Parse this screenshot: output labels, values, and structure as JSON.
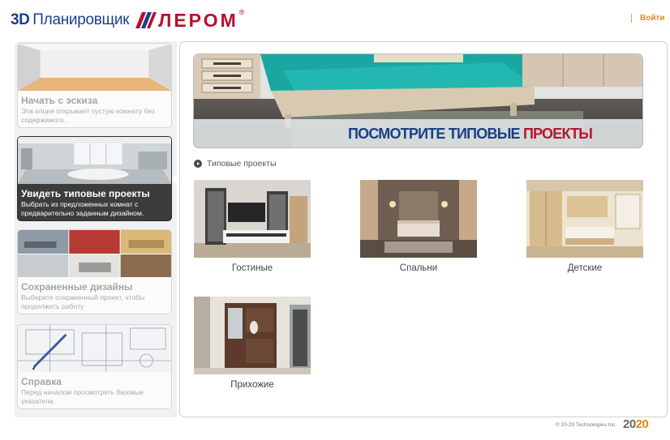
{
  "header": {
    "logo_3d": "3D",
    "logo_planner": "Планировщик",
    "logo_brand": "ЛЕРОМ",
    "logo_reg": "®",
    "login_label": "Войти"
  },
  "sidebar": {
    "items": [
      {
        "title": "Начать с эскиза",
        "desc": "Эта опция открывает пустую комнату без содержимого."
      },
      {
        "title": "Увидеть типовые проекты",
        "desc": "Выбрать из предложенных комнат с предварительно заданным дизайном."
      },
      {
        "title": "Сохраненные дизайны",
        "desc": "Выберите сохраненный проект, чтобы продолжить работу"
      },
      {
        "title": "Справка",
        "desc": "Перед началом просмотреть базовые указатели."
      }
    ],
    "active_index": 1
  },
  "main": {
    "banner": {
      "text_part1": "ПОСМОТРИТЕ ТИПОВЫЕ",
      "text_part2": "ПРОЕКТЫ"
    },
    "section_label": "Типовые проекты",
    "categories": [
      {
        "label": "Гостиные",
        "icon": "living-room-photo"
      },
      {
        "label": "Спальни",
        "icon": "bedroom-photo"
      },
      {
        "label": "Детские",
        "icon": "kids-room-photo"
      },
      {
        "label": "Прихожие",
        "icon": "hallway-photo"
      }
    ]
  },
  "footer": {
    "copyright": "© 20-20 Technologies Inc.",
    "logo_part1": "20",
    "logo_part2": "20"
  },
  "colors": {
    "brand_blue": "#1a3f8f",
    "brand_red": "#b3122b",
    "accent_orange": "#e08a1e",
    "active_card_bg": "#3c3c3c"
  }
}
